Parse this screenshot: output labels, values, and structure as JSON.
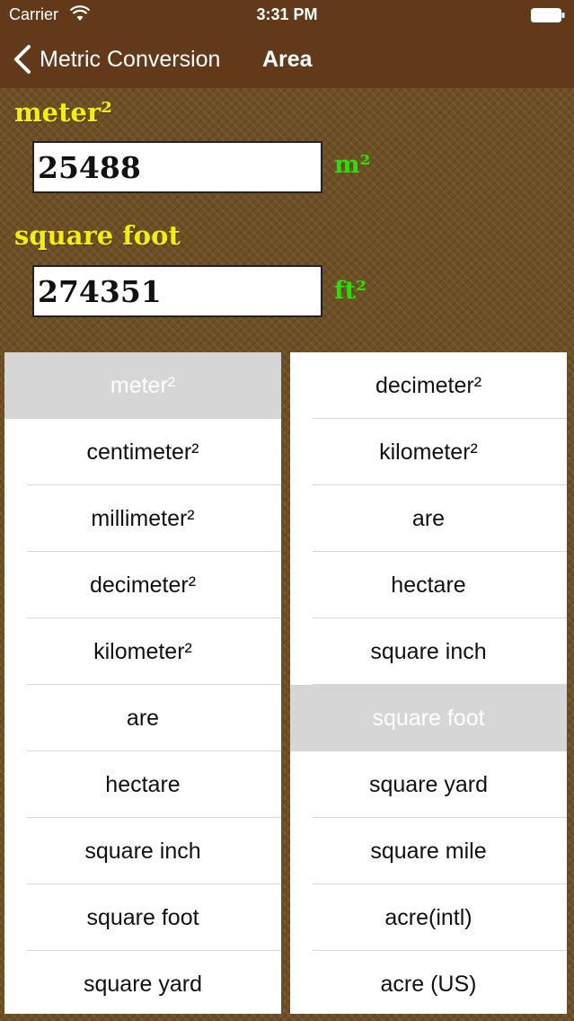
{
  "status": {
    "carrier": "Carrier",
    "time": "3:31 PM"
  },
  "nav": {
    "back_label": "Metric Conversion",
    "title": "Area"
  },
  "from": {
    "label": "meter²",
    "value": "25488",
    "symbol": "m²"
  },
  "to": {
    "label": "square foot",
    "value": "274351",
    "symbol": "ft²"
  },
  "left_picker": {
    "items": [
      "meter²",
      "centimeter²",
      "millimeter²",
      "decimeter²",
      "kilometer²",
      "are",
      "hectare",
      "square inch",
      "square foot",
      "square yard"
    ],
    "selected": "meter²"
  },
  "right_picker": {
    "items": [
      "decimeter²",
      "kilometer²",
      "are",
      "hectare",
      "square inch",
      "square foot",
      "square yard",
      "square mile",
      "acre(intl)",
      "acre (US)"
    ],
    "selected": "square foot"
  },
  "colors": {
    "bar": "#623a19",
    "label": "#f4f000",
    "symbol": "#27e100"
  }
}
